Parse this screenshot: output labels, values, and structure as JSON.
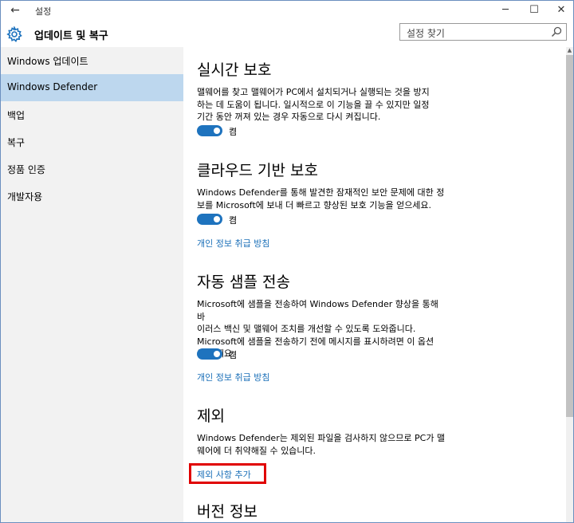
{
  "window": {
    "title": "설정",
    "back_glyph": "←",
    "minimize_glyph": "─",
    "maximize_glyph": "☐",
    "close_glyph": "✕"
  },
  "header": {
    "page_title": "업데이트 및 복구",
    "search_placeholder": "설정 찾기"
  },
  "sidebar": {
    "items": [
      {
        "label": "Windows 업데이트",
        "selected": false
      },
      {
        "label": "Windows Defender",
        "selected": true
      },
      {
        "label": "백업",
        "selected": false
      },
      {
        "label": "복구",
        "selected": false
      },
      {
        "label": "정품 인증",
        "selected": false
      },
      {
        "label": "개발자용",
        "selected": false
      }
    ]
  },
  "main": {
    "realtime": {
      "title": "실시간 보호",
      "desc_lines": [
        "맬웨어를 찾고 맬웨어가 PC에서 설치되거나 실행되는 것을 방지",
        "하는 데 도움이 됩니다. 일시적으로 이 기능을 끌 수 있지만 일정",
        "기간 동안 꺼져 있는 경우 자동으로 다시 켜집니다."
      ],
      "toggle_label": "켬"
    },
    "cloud": {
      "title": "클라우드 기반 보호",
      "desc_lines": [
        "Windows Defender를 통해 발견한 잠재적인 보안 문제에 대한 정",
        "보를 Microsoft에 보내 더 빠르고 향상된 보호 기능을 얻으세요."
      ],
      "toggle_label": "켬",
      "link": "개인 정보 취급 방침"
    },
    "sample": {
      "title": "자동 샘플 전송",
      "desc_lines": [
        "Microsoft에 샘플을 전송하여 Windows Defender 향상을 통해 바",
        "이러스 백신 및 맬웨어 조치를 개선할 수 있도록 도와줍니다.",
        "Microsoft에 샘플을 전송하기 전에 메시지를 표시하려면 이 옵션",
        "을 끄세요."
      ],
      "toggle_label": "켬",
      "link": "개인 정보 취급 방침"
    },
    "exclusion": {
      "title": "제외",
      "desc_lines": [
        "Windows Defender는 제외된 파일을 검사하지 않으므로 PC가 맬",
        "웨어에 더 취약해질 수 있습니다."
      ],
      "link": "제외 사항 추가"
    },
    "version": {
      "title": "버전 정보"
    }
  },
  "colors": {
    "accent": "#1e73be",
    "link": "#1a6fb8",
    "selected_bg": "#bdd7ee",
    "sidebar_bg": "#f2f2f2",
    "highlight": "#e00000"
  }
}
